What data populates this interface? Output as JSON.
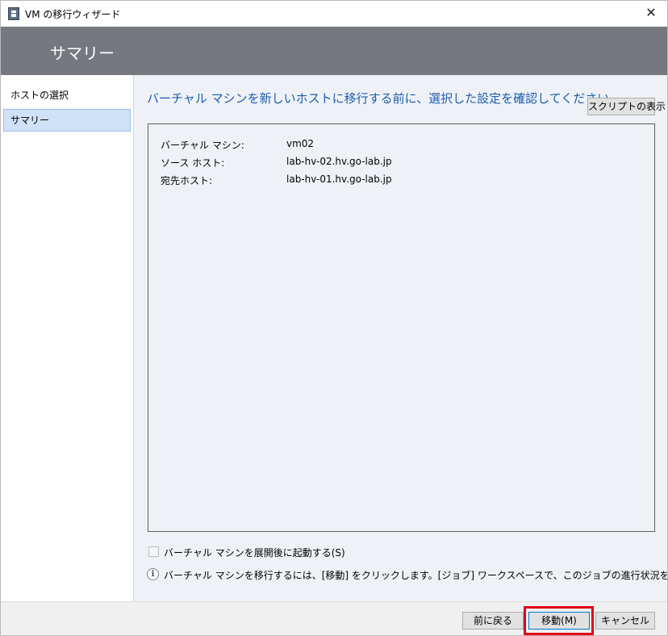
{
  "window": {
    "title": "VM の移行ウィザード",
    "close_glyph": "✕"
  },
  "header": {
    "title": "サマリー"
  },
  "nav": {
    "items": [
      {
        "label": "ホストの選択",
        "selected": false
      },
      {
        "label": "サマリー",
        "selected": true
      }
    ]
  },
  "main": {
    "heading": "バーチャル マシンを新しいホストに移行する前に、選択した設定を確認してください",
    "script_button": "スクリプトの表示",
    "summary": [
      {
        "label": "バーチャル マシン:",
        "value": "vm02"
      },
      {
        "label": "ソース ホスト:",
        "value": "lab-hv-02.hv.go-lab.jp"
      },
      {
        "label": "宛先ホスト:",
        "value": "lab-hv-01.hv.go-lab.jp"
      }
    ],
    "start_after_deploy_label": "バーチャル マシンを展開後に起動する(S)",
    "start_after_deploy_checked": false,
    "info_glyph": "i",
    "info_text": "バーチャル マシンを移行するには、[移動] をクリックします。[ジョブ] ワークスペースで、このジョブの進行状況を追跡できます。"
  },
  "buttons": {
    "back": "前に戻る",
    "move": "移動(M)",
    "cancel": "キャンセル"
  },
  "colors": {
    "header_band": "#75797f",
    "heading_blue": "#1e5bad",
    "nav_selected": "#cfe2f7",
    "highlight_red": "#e3001b"
  }
}
